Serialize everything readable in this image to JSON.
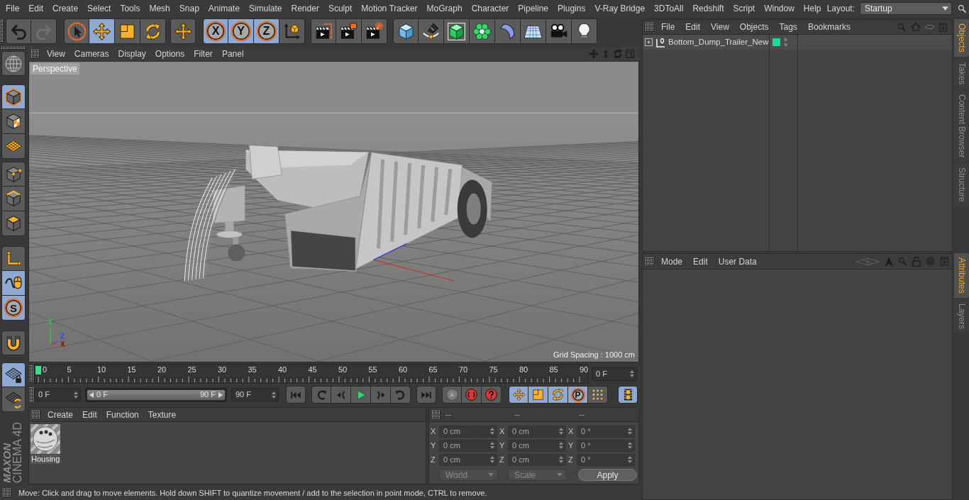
{
  "menu_bar": {
    "items": [
      "File",
      "Edit",
      "Create",
      "Select",
      "Tools",
      "Mesh",
      "Snap",
      "Animate",
      "Simulate",
      "Render",
      "Sculpt",
      "Motion Tracker",
      "MoGraph",
      "Character",
      "Pipeline",
      "Plugins",
      "V-Ray Bridge",
      "3DToAll",
      "Redshift",
      "Script",
      "Window",
      "Help"
    ],
    "layout_label": "Layout:",
    "layout_value": "Startup"
  },
  "toolbar": {
    "groups": [
      [
        {
          "kind": "undo",
          "selected": false,
          "disabled": false
        },
        {
          "kind": "redo",
          "selected": false,
          "disabled": true
        }
      ],
      [
        {
          "kind": "select",
          "selected": false
        },
        {
          "kind": "move",
          "selected": true
        },
        {
          "kind": "scale",
          "selected": false
        },
        {
          "kind": "rotate",
          "selected": false
        }
      ],
      [
        {
          "kind": "transform",
          "selected": false
        }
      ],
      [
        {
          "kind": "letter",
          "label": "X",
          "selected": true
        },
        {
          "kind": "letter",
          "label": "Y",
          "selected": true
        },
        {
          "kind": "letter",
          "label": "Z",
          "selected": true
        },
        {
          "kind": "coords",
          "selected": false
        }
      ],
      [
        {
          "kind": "renderview",
          "selected": false
        },
        {
          "kind": "renderpicture",
          "selected": false
        },
        {
          "kind": "rendersettings",
          "selected": false
        }
      ],
      [
        {
          "kind": "cube",
          "selected": false
        },
        {
          "kind": "pen",
          "selected": false
        },
        {
          "kind": "subdivision",
          "selected": false
        },
        {
          "kind": "cloner",
          "selected": false
        },
        {
          "kind": "deformer",
          "selected": false
        },
        {
          "kind": "floor",
          "selected": false
        },
        {
          "kind": "camera",
          "selected": false
        },
        {
          "kind": "light",
          "selected": false
        }
      ]
    ]
  },
  "left_toolbar": {
    "groups": [
      [
        {
          "kind": "globe",
          "selected": false
        }
      ],
      [
        {
          "kind": "model",
          "selected": true
        },
        {
          "kind": "texture",
          "selected": false
        },
        {
          "kind": "workplane",
          "selected": false
        }
      ],
      [
        {
          "kind": "points",
          "selected": false
        },
        {
          "kind": "edges",
          "selected": false
        },
        {
          "kind": "polygons",
          "selected": false
        }
      ],
      [
        {
          "kind": "axis",
          "selected": false
        },
        {
          "kind": "tweak",
          "selected": true
        },
        {
          "kind": "letter",
          "label": "S",
          "selected": true
        }
      ],
      [
        {
          "kind": "magnet",
          "selected": false
        }
      ],
      [
        {
          "kind": "gridlock",
          "selected": true
        },
        {
          "kind": "gridrotate",
          "selected": false
        }
      ]
    ],
    "logo": {
      "brand": "MAXON",
      "product": "CINEMA 4D"
    }
  },
  "viewport": {
    "menu": [
      "View",
      "Cameras",
      "Display",
      "Options",
      "Filter",
      "Panel"
    ],
    "camera": "Perspective",
    "axis_labels": [
      "Y",
      "Z",
      "X"
    ],
    "grid_spacing": "Grid Spacing : 1000 cm"
  },
  "timeline": {
    "ruler_labels": [
      "0",
      "5",
      "10",
      "15",
      "20",
      "25",
      "30",
      "35",
      "40",
      "45",
      "50",
      "55",
      "60",
      "65",
      "70",
      "75",
      "80",
      "85",
      "90"
    ],
    "playhead": {
      "level": 0
    },
    "current_frame": "0 F",
    "start_frame": "0 F",
    "range": {
      "start": "0 F",
      "end": "90 F",
      "level": 1
    },
    "end_frame": "90 F",
    "transport": [
      [
        {
          "kind": "first"
        }
      ],
      [
        {
          "kind": "prevkey"
        },
        {
          "kind": "prevframe"
        },
        {
          "kind": "play"
        },
        {
          "kind": "nextframe"
        },
        {
          "kind": "nextkey"
        }
      ],
      [
        {
          "kind": "last"
        }
      ]
    ],
    "record": [
      {
        "kind": "keyframe",
        "disabled": true
      },
      {
        "kind": "record",
        "disabled": false
      },
      {
        "kind": "autokey",
        "disabled": false
      }
    ],
    "key_tracks": [
      {
        "kind": "move",
        "selected": true
      },
      {
        "kind": "scale",
        "selected": true
      },
      {
        "kind": "rotate",
        "selected": true
      },
      {
        "kind": "letter",
        "label": "P",
        "selected": true
      },
      {
        "kind": "pointlevel",
        "selected": false
      }
    ],
    "scheme": [
      {
        "kind": "film",
        "selected": true
      }
    ]
  },
  "materials": {
    "menu": [
      "Create",
      "Edit",
      "Function",
      "Texture"
    ],
    "items": [
      {
        "name": "Housing"
      }
    ]
  },
  "coordinates": {
    "headers": [
      "--",
      "--",
      "--"
    ],
    "disabled": true,
    "rows": [
      {
        "cells": [
          {
            "axis": "X",
            "value": "0 cm"
          },
          {
            "axis": "X",
            "value": "0 cm"
          },
          {
            "axis": "X",
            "value": "0 °"
          }
        ]
      },
      {
        "cells": [
          {
            "axis": "Y",
            "value": "0 cm"
          },
          {
            "axis": "Y",
            "value": "0 cm"
          },
          {
            "axis": "Y",
            "value": "0 °"
          }
        ]
      },
      {
        "cells": [
          {
            "axis": "Z",
            "value": "0 cm"
          },
          {
            "axis": "Z",
            "value": "0 cm"
          },
          {
            "axis": "Z",
            "value": "0 °"
          }
        ]
      }
    ],
    "dropdowns": [
      {
        "value": "World",
        "disabled": true
      },
      {
        "value": "Scale",
        "disabled": true
      }
    ],
    "apply": "Apply"
  },
  "status_bar": {
    "text": "Move: Click and drag to move elements. Hold down SHIFT to quantize movement / add to the selection in point mode, CTRL to remove."
  },
  "objects_panel": {
    "menu": [
      "File",
      "Edit",
      "View",
      "Objects",
      "Tags",
      "Bookmarks"
    ],
    "objects": [
      {
        "name": "Bottom_Dump_Trailer_New",
        "expanded": false,
        "color": "#20d898"
      }
    ]
  },
  "attributes_panel": {
    "menu": [
      "Mode",
      "Edit",
      "User Data"
    ]
  },
  "side_tabs": {
    "top": [
      {
        "label": "Objects",
        "selected": true
      },
      {
        "label": "Takes",
        "selected": false
      },
      {
        "label": "Content Browser",
        "selected": false
      },
      {
        "label": "Structure",
        "selected": false
      }
    ],
    "bottom": [
      {
        "label": "Attributes",
        "selected": true
      },
      {
        "label": "Layers",
        "selected": false
      }
    ]
  }
}
